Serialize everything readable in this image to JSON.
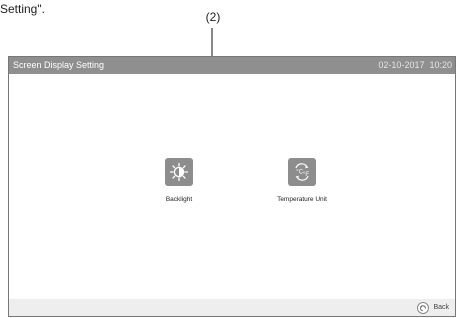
{
  "document": {
    "fragment_text": "Setting\".",
    "callout_label": "(2)"
  },
  "screen": {
    "title": "Screen Display Setting",
    "date": "02-10-2017",
    "time": "10:20"
  },
  "tiles": [
    {
      "label": "Backlight",
      "icon": "backlight-icon"
    },
    {
      "label": "Temperature Unit",
      "icon": "temperature-unit-icon"
    }
  ],
  "footer": {
    "back_label": "Back",
    "back_icon": "back-arrow-icon"
  },
  "colors": {
    "title_bar": "#8f8f8f",
    "icon_tile": "#8d8d8d",
    "footer_bar": "#eeeeee"
  }
}
